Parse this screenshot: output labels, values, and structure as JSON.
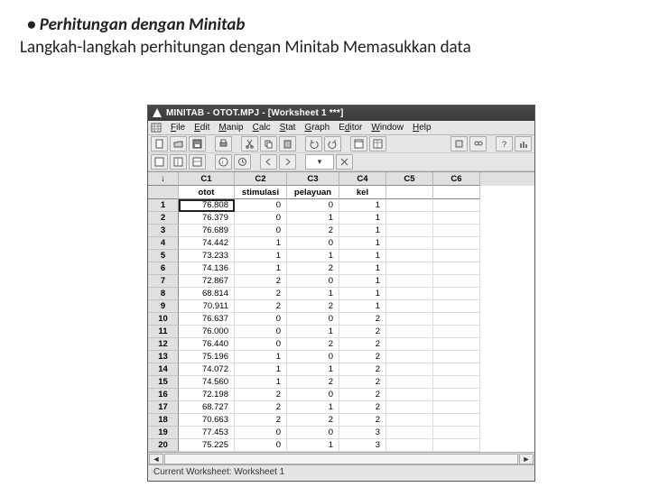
{
  "slide": {
    "bullet": "•",
    "heading": "Perhitungan dengan Minitab",
    "subtext": "Langkah-langkah perhitungan dengan Minitab Memasukkan data"
  },
  "window": {
    "title": "MINITAB - OTOT.MPJ - [Worksheet 1 ***]",
    "menus": [
      {
        "label": "File",
        "ul": "F"
      },
      {
        "label": "Edit",
        "ul": "E"
      },
      {
        "label": "Manip",
        "ul": "M"
      },
      {
        "label": "Calc",
        "ul": "C"
      },
      {
        "label": "Stat",
        "ul": "S"
      },
      {
        "label": "Graph",
        "ul": "G"
      },
      {
        "label": "Editor",
        "ul": "d"
      },
      {
        "label": "Window",
        "ul": "W"
      },
      {
        "label": "Help",
        "ul": "H"
      }
    ],
    "columns": [
      "C1",
      "C2",
      "C3",
      "C4",
      "C5",
      "C6"
    ],
    "varnames": [
      "otot",
      "stimulasi",
      "pelayuan",
      "kel",
      "",
      ""
    ],
    "corner": "↓",
    "rows": [
      {
        "n": 1,
        "v": [
          "76.808",
          "0",
          "0",
          "1",
          "",
          ""
        ]
      },
      {
        "n": 2,
        "v": [
          "76.379",
          "0",
          "1",
          "1",
          "",
          ""
        ]
      },
      {
        "n": 3,
        "v": [
          "76.689",
          "0",
          "2",
          "1",
          "",
          ""
        ]
      },
      {
        "n": 4,
        "v": [
          "74.442",
          "1",
          "0",
          "1",
          "",
          ""
        ]
      },
      {
        "n": 5,
        "v": [
          "73.233",
          "1",
          "1",
          "1",
          "",
          ""
        ]
      },
      {
        "n": 6,
        "v": [
          "74.136",
          "1",
          "2",
          "1",
          "",
          ""
        ]
      },
      {
        "n": 7,
        "v": [
          "72.867",
          "2",
          "0",
          "1",
          "",
          ""
        ]
      },
      {
        "n": 8,
        "v": [
          "68.814",
          "2",
          "1",
          "1",
          "",
          ""
        ]
      },
      {
        "n": 9,
        "v": [
          "70.911",
          "2",
          "2",
          "1",
          "",
          ""
        ]
      },
      {
        "n": 10,
        "v": [
          "76.637",
          "0",
          "0",
          "2",
          "",
          ""
        ]
      },
      {
        "n": 11,
        "v": [
          "76.000",
          "0",
          "1",
          "2",
          "",
          ""
        ]
      },
      {
        "n": 12,
        "v": [
          "76.440",
          "0",
          "2",
          "2",
          "",
          ""
        ]
      },
      {
        "n": 13,
        "v": [
          "75.196",
          "1",
          "0",
          "2",
          "",
          ""
        ]
      },
      {
        "n": 14,
        "v": [
          "74.072",
          "1",
          "1",
          "2",
          "",
          ""
        ]
      },
      {
        "n": 15,
        "v": [
          "74.560",
          "1",
          "2",
          "2",
          "",
          ""
        ]
      },
      {
        "n": 16,
        "v": [
          "72.198",
          "2",
          "0",
          "2",
          "",
          ""
        ]
      },
      {
        "n": 17,
        "v": [
          "68.727",
          "2",
          "1",
          "2",
          "",
          ""
        ]
      },
      {
        "n": 18,
        "v": [
          "70.663",
          "2",
          "2",
          "2",
          "",
          ""
        ]
      },
      {
        "n": 19,
        "v": [
          "77.453",
          "0",
          "0",
          "3",
          "",
          ""
        ]
      },
      {
        "n": 20,
        "v": [
          "75.225",
          "0",
          "1",
          "3",
          "",
          ""
        ]
      }
    ],
    "status": "Current Worksheet: Worksheet 1"
  },
  "icons": {
    "new": "new-file",
    "open": "folder-open",
    "save": "floppy",
    "print": "printer",
    "cut": "scissors",
    "copy": "copy",
    "paste": "clipboard",
    "undo": "undo",
    "redo": "redo",
    "help": "help",
    "find": "binoculars",
    "chart": "chart",
    "session": "session",
    "worksheet": "worksheet",
    "info": "info",
    "history": "history",
    "last": "last-dialog",
    "cmd": "command"
  }
}
